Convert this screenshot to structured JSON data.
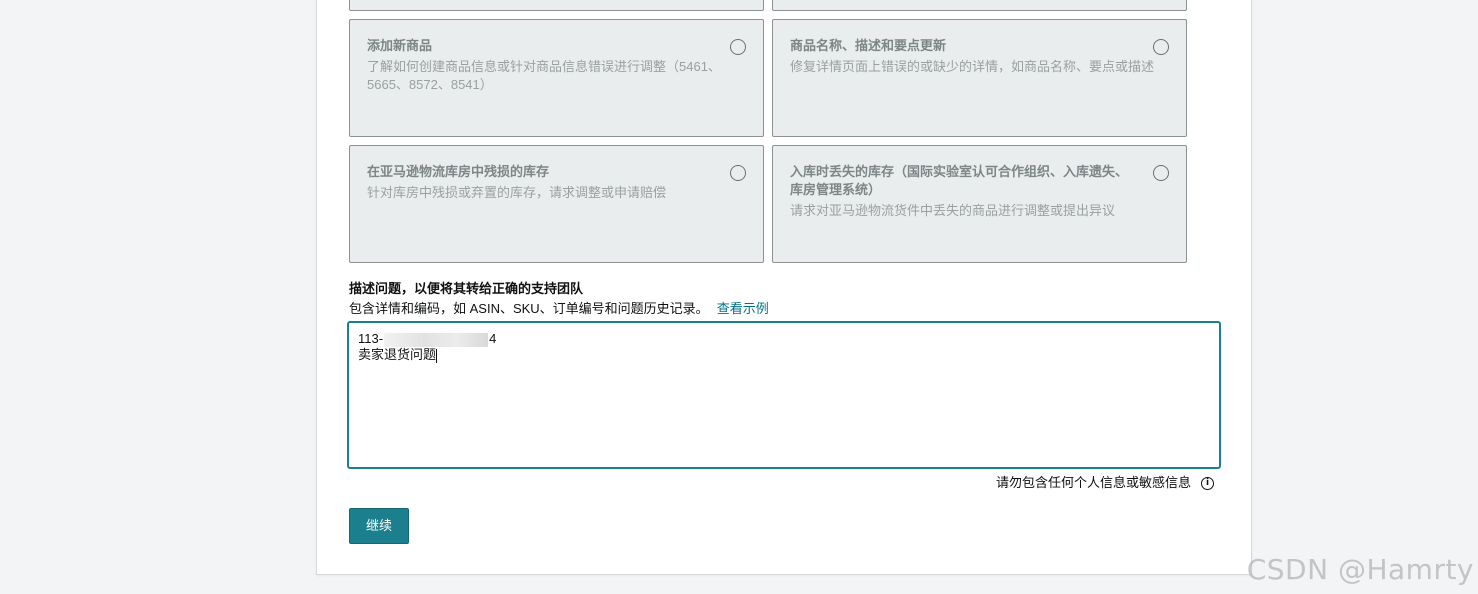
{
  "cards": [
    {
      "title": "添加新商品",
      "description": "了解如何创建商品信息或针对商品信息错误进行调整（5461、5665、8572、8541）"
    },
    {
      "title": "商品名称、描述和要点更新",
      "description": "修复详情页面上错误的或缺少的详情，如商品名称、要点或描述"
    },
    {
      "title": "在亚马逊物流库房中残损的库存",
      "description": "针对库房中残损或弃置的库存，请求调整或申请赔偿"
    },
    {
      "title": "入库时丢失的库存（国际实验室认可合作组织、入库遗失、库房管理系统）",
      "description": "请求对亚马逊物流货件中丢失的商品进行调整或提出异议"
    }
  ],
  "describe": {
    "title": "描述问题，以便将其转给正确的支持团队",
    "hint": "包含详情和编码，如 ASIN、SKU、订单编号和问题历史记录。",
    "example_link": "查看示例",
    "value_line1_prefix": "113-",
    "value_line1_suffix": "4",
    "value_line2": "卖家退货问题"
  },
  "privacy_note": "请勿包含任何个人信息或敏感信息",
  "continue_label": "继续",
  "watermark": "CSDN @Hamrty"
}
